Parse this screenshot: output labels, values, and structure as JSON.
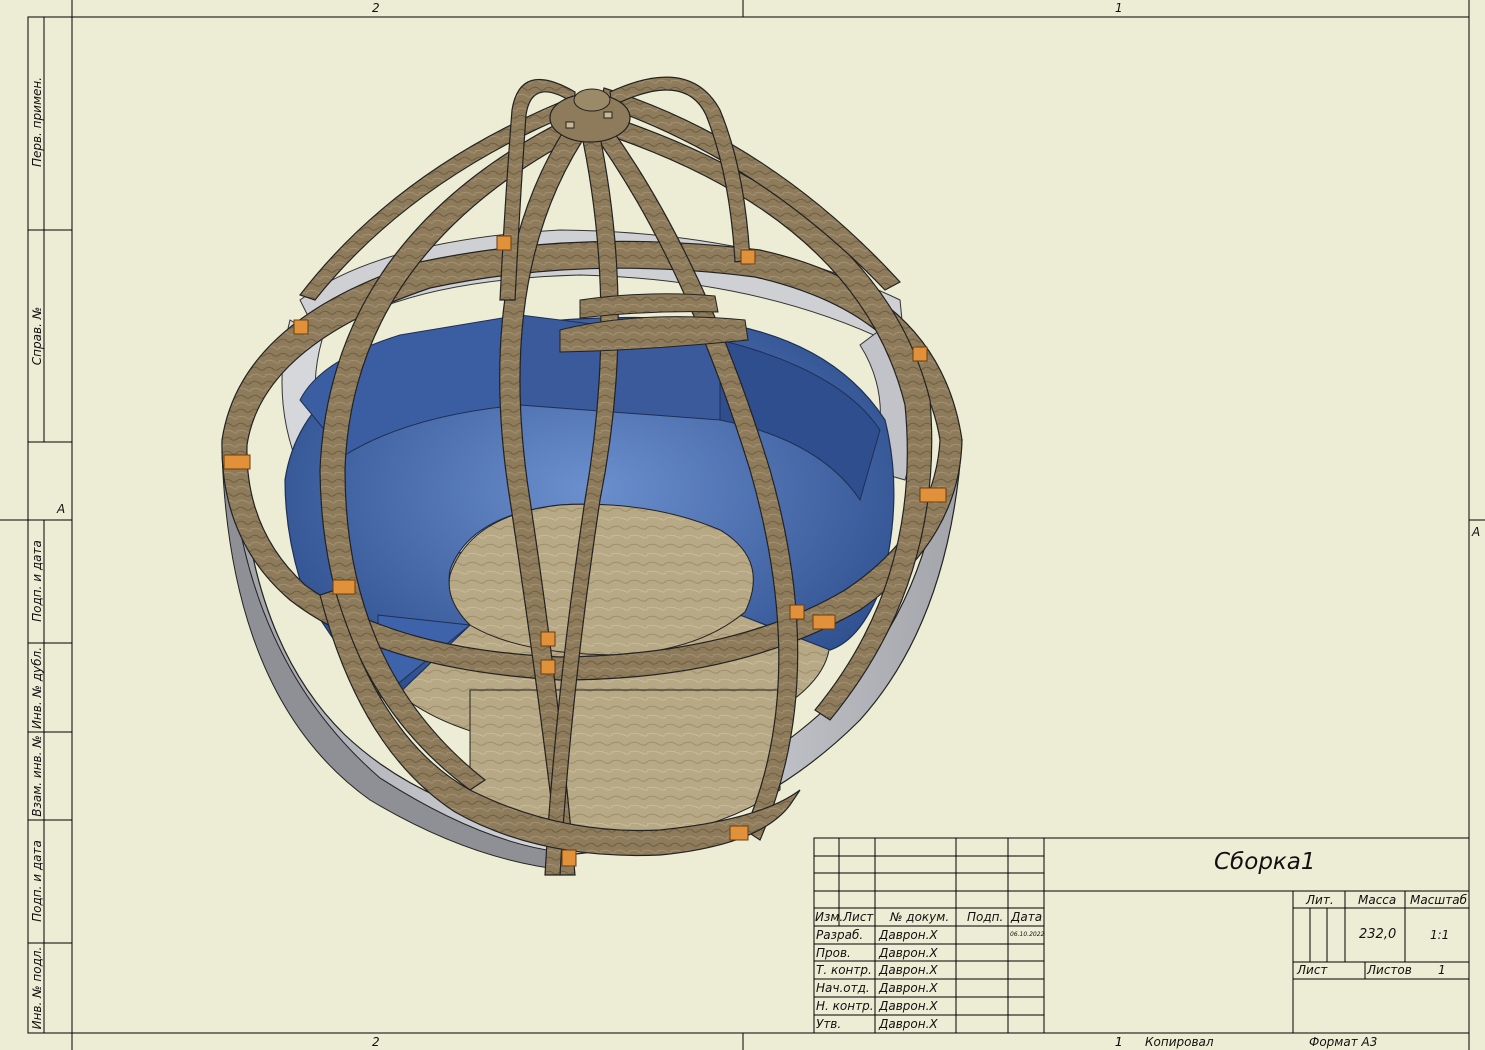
{
  "zones": {
    "top": [
      "2",
      "1"
    ],
    "bottom": [
      "2",
      "1"
    ],
    "side": [
      "A",
      "A"
    ]
  },
  "left_strip": [
    "Перв. примен.",
    "Справ. №",
    "Подп. и дата",
    "Инв. № дубл.",
    "Взам. инв. №",
    "Подп. и дата",
    "Инв. № подл."
  ],
  "title_block": {
    "designation": "Сборка1",
    "headers": {
      "izm": "Изм.",
      "list": "Лист",
      "doc": "№ докум.",
      "podp": "Подп.",
      "data": "Дата"
    },
    "roles": [
      "Разраб.",
      "Пров.",
      "Т. контр.",
      "Нач.отд.",
      "Н. контр.",
      "Утв."
    ],
    "signers": [
      "Даврон.Х",
      "Даврон.Х",
      "Даврон.Х",
      "Даврон.Х",
      "Даврон.Х",
      "Даврон.Х"
    ],
    "date": "06.10.2022",
    "lit_label": "Лит.",
    "mass_label": "Масса",
    "scale_label": "Масштаб",
    "mass": "232,0",
    "scale": "1:1",
    "sheet_label": "Лист",
    "sheets_label": "Листов",
    "sheets_count": "1"
  },
  "footer": {
    "sheet_no": "1",
    "copied": "Копировал",
    "format": "Формат А3"
  },
  "colors": {
    "paper": "#ededd6",
    "line": "#000000",
    "wood": "#8c7b5c",
    "cushion": "#3d5f9e",
    "bracket": "#e0913a"
  }
}
